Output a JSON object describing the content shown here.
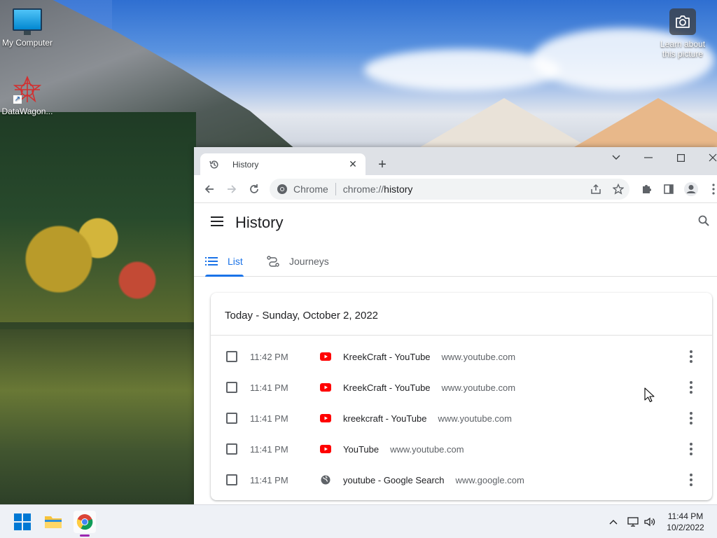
{
  "desktop": {
    "icons": [
      {
        "label": "My Computer",
        "icon": "monitor-icon"
      },
      {
        "label": "DataWagon...",
        "icon": "datawagon-icon"
      }
    ],
    "learn_picture": {
      "label_line1": "Learn about",
      "label_line2": "this picture",
      "icon": "camera-icon"
    }
  },
  "browser": {
    "tab": {
      "title": "History",
      "icon": "history-icon"
    },
    "omnibox": {
      "chip": "Chrome",
      "url_scheme": "chrome://",
      "url_host": "history"
    }
  },
  "history": {
    "title": "History",
    "tabs": [
      {
        "label": "List",
        "active": true
      },
      {
        "label": "Journeys",
        "active": false
      }
    ],
    "date_header": "Today - Sunday, October 2, 2022",
    "entries": [
      {
        "time": "11:42 PM",
        "title": "KreekCraft - YouTube",
        "domain": "www.youtube.com",
        "favicon": "youtube"
      },
      {
        "time": "11:41 PM",
        "title": "KreekCraft - YouTube",
        "domain": "www.youtube.com",
        "favicon": "youtube"
      },
      {
        "time": "11:41 PM",
        "title": "kreekcraft - YouTube",
        "domain": "www.youtube.com",
        "favicon": "youtube"
      },
      {
        "time": "11:41 PM",
        "title": "YouTube",
        "domain": "www.youtube.com",
        "favicon": "youtube"
      },
      {
        "time": "11:41 PM",
        "title": "youtube - Google Search",
        "domain": "www.google.com",
        "favicon": "globe"
      }
    ]
  },
  "taskbar": {
    "clock_time": "11:44 PM",
    "clock_date": "10/2/2022"
  },
  "colors": {
    "accent": "#1a73e8",
    "youtube_red": "#ff0000"
  }
}
